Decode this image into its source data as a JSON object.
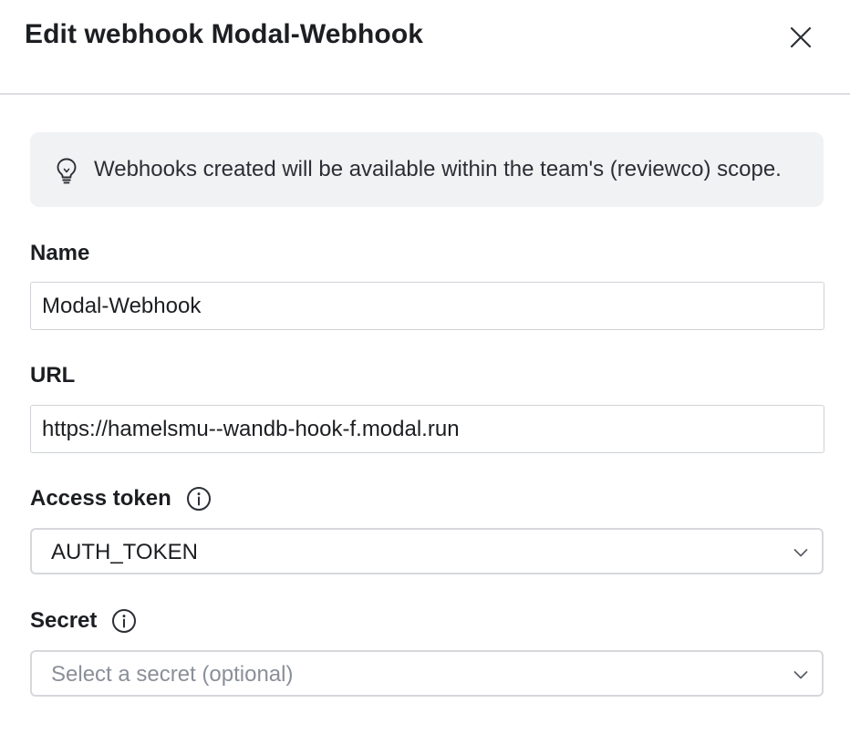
{
  "modal": {
    "title": "Edit webhook Modal-Webhook",
    "close_icon": "close-icon"
  },
  "banner": {
    "icon": "lightbulb-icon",
    "text": "Webhooks created will be available within the team's (reviewco) scope."
  },
  "form": {
    "name": {
      "label": "Name",
      "value": "Modal-Webhook"
    },
    "url": {
      "label": "URL",
      "value": "https://hamelsmu--wandb-hook-f.modal.run"
    },
    "access_token": {
      "label": "Access token",
      "info_icon": "info-icon",
      "selected": "AUTH_TOKEN"
    },
    "secret": {
      "label": "Secret",
      "info_icon": "info-icon",
      "placeholder": "Select a secret (optional)"
    }
  },
  "colors": {
    "banner_bg": "#f1f2f4",
    "divider": "#dcdee2",
    "placeholder_text": "#8a8f98",
    "input_border": "#cfd2d6"
  }
}
